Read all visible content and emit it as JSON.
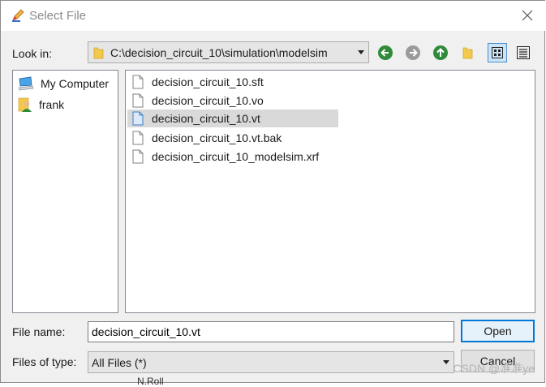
{
  "window": {
    "title": "Select File"
  },
  "toolbar": {
    "look_in_label": "Look in:",
    "path": "C:\\decision_circuit_10\\simulation\\modelsim"
  },
  "sidebar": {
    "items": [
      {
        "label": "My Computer"
      },
      {
        "label": "frank"
      }
    ]
  },
  "files": [
    {
      "name": "decision_circuit_10.sft"
    },
    {
      "name": "decision_circuit_10.vo"
    },
    {
      "name": "decision_circuit_10.vt"
    },
    {
      "name": "decision_circuit_10.vt.bak"
    },
    {
      "name": "decision_circuit_10_modelsim.xrf"
    }
  ],
  "footer": {
    "file_name_label": "File name:",
    "file_name_value": "decision_circuit_10.vt",
    "files_of_type_label": "Files of type:",
    "files_of_type_value": "All Files (*)",
    "open_label": "Open",
    "cancel_label": "Cancel",
    "partial_text": "N.Roll"
  },
  "watermark": "CSDN @准准ye",
  "colors": {
    "accent": "#0078d7",
    "selection": "#d9d9d9",
    "nav_green": "#2e8b3a"
  }
}
